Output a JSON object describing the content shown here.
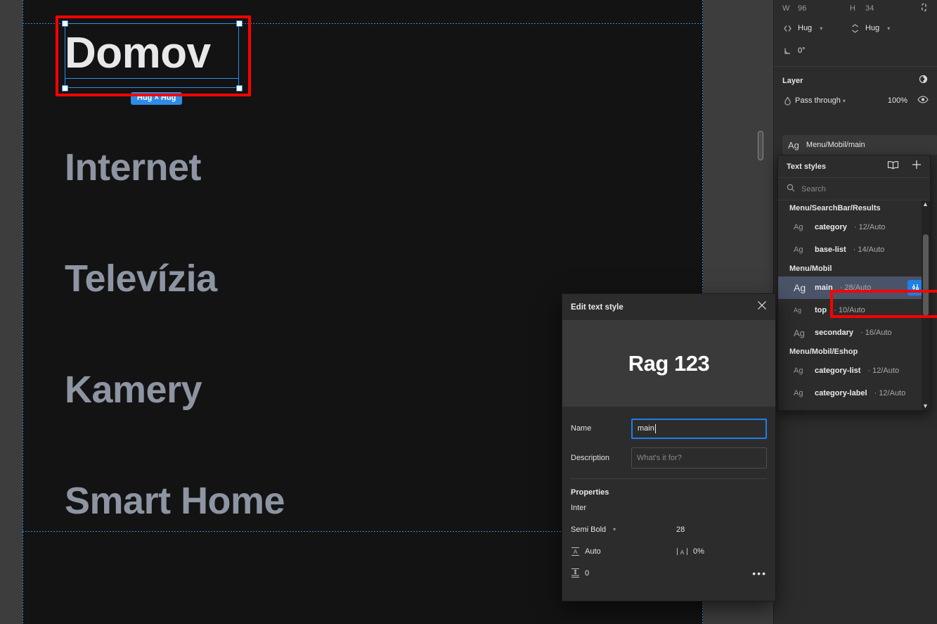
{
  "canvas": {
    "selected_text": "Domov",
    "size_badge": "Hug × Hug",
    "menu_items": [
      {
        "label": "Internet"
      },
      {
        "label": "Televízia"
      },
      {
        "label": "Kamery"
      },
      {
        "label": "Smart Home"
      }
    ]
  },
  "right_panel": {
    "dimensions": {
      "w_label": "W",
      "w_value": "96",
      "h_label": "H",
      "h_value": "34",
      "horizontal_resizing": "Hug",
      "vertical_resizing": "Hug",
      "rotation": "0°"
    },
    "layer": {
      "title": "Layer",
      "blend_mode": "Pass through",
      "opacity": "100%"
    },
    "selected_style": {
      "ag": "Ag",
      "name": "Menu/Mobil/main"
    },
    "text_styles": {
      "title": "Text styles",
      "search_placeholder": "Search",
      "groups": [
        {
          "group": "Menu/SearchBar/Results",
          "items": [
            {
              "ag": "Ag",
              "name": "category",
              "meta": "· 12/Auto",
              "active": false
            },
            {
              "ag": "Ag",
              "name": "base-list",
              "meta": "· 14/Auto",
              "active": false
            }
          ]
        },
        {
          "group": "Menu/Mobil",
          "items": [
            {
              "ag": "Ag",
              "name": "main",
              "meta": "· 28/Auto",
              "active": true
            },
            {
              "ag": "Ag",
              "name": "top",
              "meta": "· 10/Auto",
              "active": false
            },
            {
              "ag": "Ag",
              "name": "secondary",
              "meta": "· 16/Auto",
              "active": false
            }
          ]
        },
        {
          "group": "Menu/Mobil/Eshop",
          "items": [
            {
              "ag": "Ag",
              "name": "category-list",
              "meta": "· 12/Auto",
              "active": false
            },
            {
              "ag": "Ag",
              "name": "category-label",
              "meta": "· 12/Auto",
              "active": false
            }
          ]
        }
      ]
    }
  },
  "dialog": {
    "title": "Edit text style",
    "preview_text": "Rag 123",
    "name_label": "Name",
    "name_value": "main",
    "description_label": "Description",
    "description_placeholder": "What's it for?",
    "properties_title": "Properties",
    "font_family": "Inter",
    "font_weight": "Semi Bold",
    "font_size": "28",
    "line_height": "Auto",
    "letter_spacing": "0%",
    "paragraph_spacing": "0",
    "more_label": "•••"
  },
  "colors": {
    "accent_blue": "#1f7fe8",
    "selection_blue": "#2e8ce8",
    "annotation_red": "#ff0000",
    "canvas_frame": "#131313",
    "panel_bg": "#2c2c2c",
    "menu_text": "#8d94a2"
  }
}
